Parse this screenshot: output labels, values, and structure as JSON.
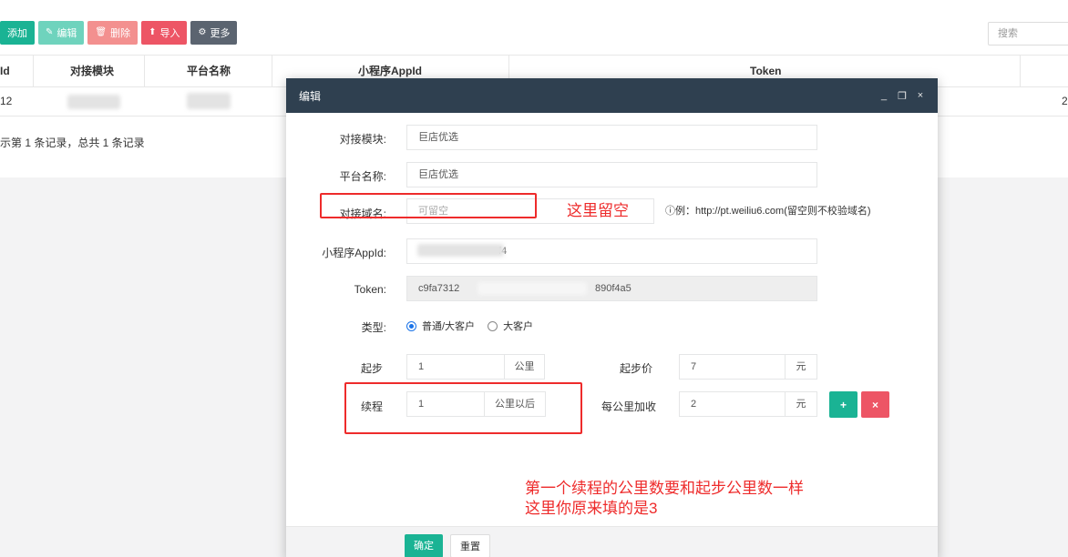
{
  "toolbar": {
    "add": "添加",
    "edit": "编辑",
    "delete": "删除",
    "import": "导入",
    "more": "更多",
    "search_placeholder": "搜索"
  },
  "table": {
    "headers": [
      "Id",
      "对接模块",
      "平台名称",
      "小程序AppId",
      "Token"
    ],
    "row": {
      "id": "12",
      "tail": "2"
    }
  },
  "pager": {
    "text": "示第 1 条记录，总共 1 条记录"
  },
  "modal": {
    "title": "编辑",
    "window_controls": {
      "minimize": "_",
      "restore": "❐",
      "close": "×"
    },
    "fields": {
      "module": {
        "label": "对接模块:",
        "value": "巨店优选"
      },
      "platform": {
        "label": "平台名称:",
        "value": "巨店优选"
      },
      "domain": {
        "label": "对接域名:",
        "placeholder": "可留空",
        "hint": "例：http://pt.weiliu6.com(留空则不校验域名)"
      },
      "appid": {
        "label": "小程序AppId:",
        "value": "f4"
      },
      "token": {
        "label": "Token:",
        "value_start": "c9fa7312",
        "value_end": "890f4a5"
      },
      "type": {
        "label": "类型:",
        "options": [
          "普通/大客户",
          "大客户"
        ],
        "selected": 0
      },
      "start": {
        "label": "起步",
        "value": "1",
        "unit": "公里"
      },
      "start_price": {
        "label": "起步价",
        "value": "7",
        "unit": "元"
      },
      "cont": {
        "label": "续程",
        "value": "1",
        "unit": "公里以后"
      },
      "per_km": {
        "label": "每公里加收",
        "value": "2",
        "unit": "元"
      }
    },
    "buttons": {
      "confirm": "确定",
      "reset": "重置",
      "add_icon": "+",
      "remove_icon": "×"
    }
  },
  "annotations": {
    "leave_empty": "这里留空",
    "note_line1": "第一个续程的公里数要和起步公里数一样",
    "note_line2": "这里你原来填的是3"
  },
  "colors": {
    "primary": "#1ab394",
    "danger": "#ed5565",
    "header": "#2f4050",
    "annotation": "#ee2b2b"
  }
}
